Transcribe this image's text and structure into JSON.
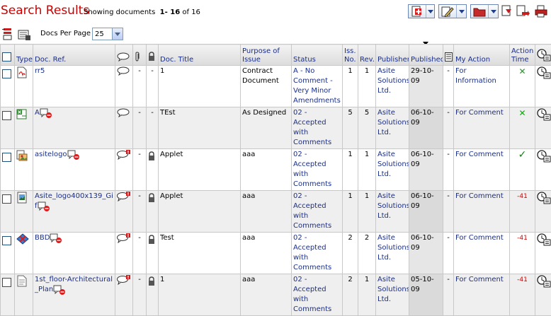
{
  "header": {
    "title": "Search Results",
    "showing_prefix": "Showing documents",
    "range": "1- 16",
    "of_label": "of",
    "total": "16"
  },
  "toolbar": {
    "docs_per_page_label": "Docs Per Page",
    "docs_per_page_value": "25"
  },
  "columns": {
    "type": "Type",
    "doc_ref": "Doc. Ref.",
    "doc_title": "Doc. Title",
    "purpose": "Purpose of Issue",
    "status": "Status",
    "iss_no": "Iss. No.",
    "rev": "Rev.",
    "publisher": "Publisher",
    "published": "Published",
    "my_action": "My Action",
    "action_time": "Action Time"
  },
  "rows": [
    {
      "ref": "rr5",
      "ref_noaccess": false,
      "comment_flag": false,
      "attach": "-",
      "locked": false,
      "title": "1",
      "purpose": "Contract Document",
      "status": "A - No Comment - Very Minor Amendments",
      "iss": "1",
      "rev": "1",
      "publisher": "Asite Solutions Ltd.",
      "published": "29-10-09",
      "dash": "-",
      "action": "For Information",
      "action_time": "✕",
      "action_time_kind": "x",
      "type_icon": "pdf-icon"
    },
    {
      "ref": "A",
      "ref_noaccess": true,
      "comment_flag": false,
      "attach": "-",
      "locked": false,
      "title": "TEst",
      "purpose": "As Designed",
      "status": "02 - Accepted with Comments",
      "iss": "5",
      "rev": "5",
      "publisher": "Asite Solutions Ltd.",
      "published": "06-10-09",
      "dash": "-",
      "action": "For Comment",
      "action_time": "✕",
      "action_time_kind": "x",
      "type_icon": "excel-icon"
    },
    {
      "ref": "asitelogo",
      "ref_noaccess": true,
      "comment_flag": true,
      "attach": "-",
      "locked": true,
      "title": "Applet",
      "purpose": "aaa",
      "status": "02 - Accepted with Comments",
      "iss": "1",
      "rev": "1",
      "publisher": "Asite Solutions Ltd.",
      "published": "06-10-09",
      "dash": "-",
      "action": "For Comment",
      "action_time": "✓",
      "action_time_kind": "check",
      "type_icon": "image-icon"
    },
    {
      "ref": "Asite_logo400x139_Gif",
      "ref_noaccess": true,
      "comment_flag": true,
      "attach": "-",
      "locked": true,
      "title": "Applet",
      "purpose": "aaa",
      "status": "02 - Accepted with Comments",
      "iss": "1",
      "rev": "1",
      "publisher": "Asite Solutions Ltd.",
      "published": "06-10-09",
      "dash": "-",
      "action": "For Comment",
      "action_time": "-41",
      "action_time_kind": "neg",
      "type_icon": "gif-icon"
    },
    {
      "ref": "BBD",
      "ref_noaccess": true,
      "comment_flag": true,
      "attach": "-",
      "locked": true,
      "title": "Test",
      "purpose": "aaa",
      "status": "02 - Accepted with Comments",
      "iss": "2",
      "rev": "2",
      "publisher": "Asite Solutions Ltd.",
      "published": "06-10-09",
      "dash": "-",
      "action": "For Comment",
      "action_time": "-41",
      "action_time_kind": "neg",
      "type_icon": "cad-icon"
    },
    {
      "ref": "1st_floor-Architectural_Plan",
      "ref_noaccess": true,
      "comment_flag": true,
      "attach": "-",
      "locked": true,
      "title": "1",
      "purpose": "aaa",
      "status": "02 - Accepted with Comments",
      "iss": "2",
      "rev": "1",
      "publisher": "Asite Solutions Ltd.",
      "published": "05-10-09",
      "dash": "-",
      "action": "For Comment",
      "action_time": "-41",
      "action_time_kind": "neg",
      "type_icon": "plan-icon"
    }
  ]
}
